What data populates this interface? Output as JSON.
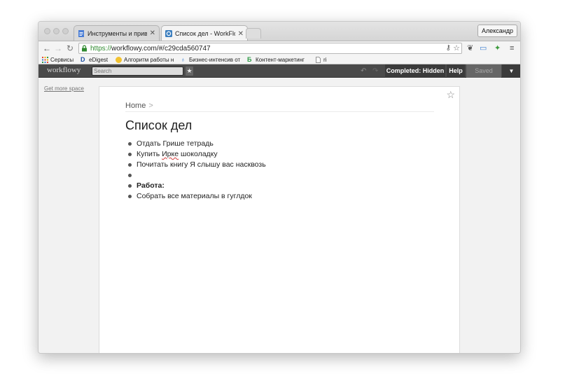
{
  "tabs": [
    {
      "title": "Инструменты и привычки",
      "active": false
    },
    {
      "title": "Список дел - WorkFlowy",
      "active": true
    }
  ],
  "profile_name": "Александр",
  "address": {
    "scheme": "https://",
    "rest": "workflowy.com/#/c29cda560747"
  },
  "bookmarks": [
    "Сервисы",
    "eDigest",
    "Алгоритм работы н",
    "Бизнес-интенсив от",
    "Контент-маркетинг",
    "ri"
  ],
  "workflowy": {
    "logo": "workflowy",
    "search_placeholder": "Search",
    "star_glyph": "★",
    "completed_label": "Completed: Hidden",
    "help_label": "Help",
    "saved_label": "Saved",
    "menu_glyph": "▼",
    "sidebar_link": "Get more space"
  },
  "page": {
    "breadcrumb_home": "Home",
    "breadcrumb_sep": ">",
    "title": "Список дел",
    "items": [
      {
        "before": "Отдать Грише тетрадь",
        "mark": "",
        "after": "",
        "bold": false
      },
      {
        "before": "Купить ",
        "mark": "Ирке",
        "after": " шоколадку",
        "bold": false
      },
      {
        "before": "Почитать книгу Я слышу вас насквозь",
        "mark": "",
        "after": "",
        "bold": false
      },
      {
        "before": "",
        "mark": "",
        "after": "",
        "bold": false
      },
      {
        "before": "Работа:",
        "mark": "",
        "after": "",
        "bold": true
      },
      {
        "before": "Собрать все материалы в гуглдок",
        "mark": "",
        "after": "",
        "bold": false
      }
    ]
  },
  "colors": {
    "header_bg": "#4a4a4a",
    "url_scheme": "#2f8a2f",
    "spellcheck": "#d23a3a"
  }
}
